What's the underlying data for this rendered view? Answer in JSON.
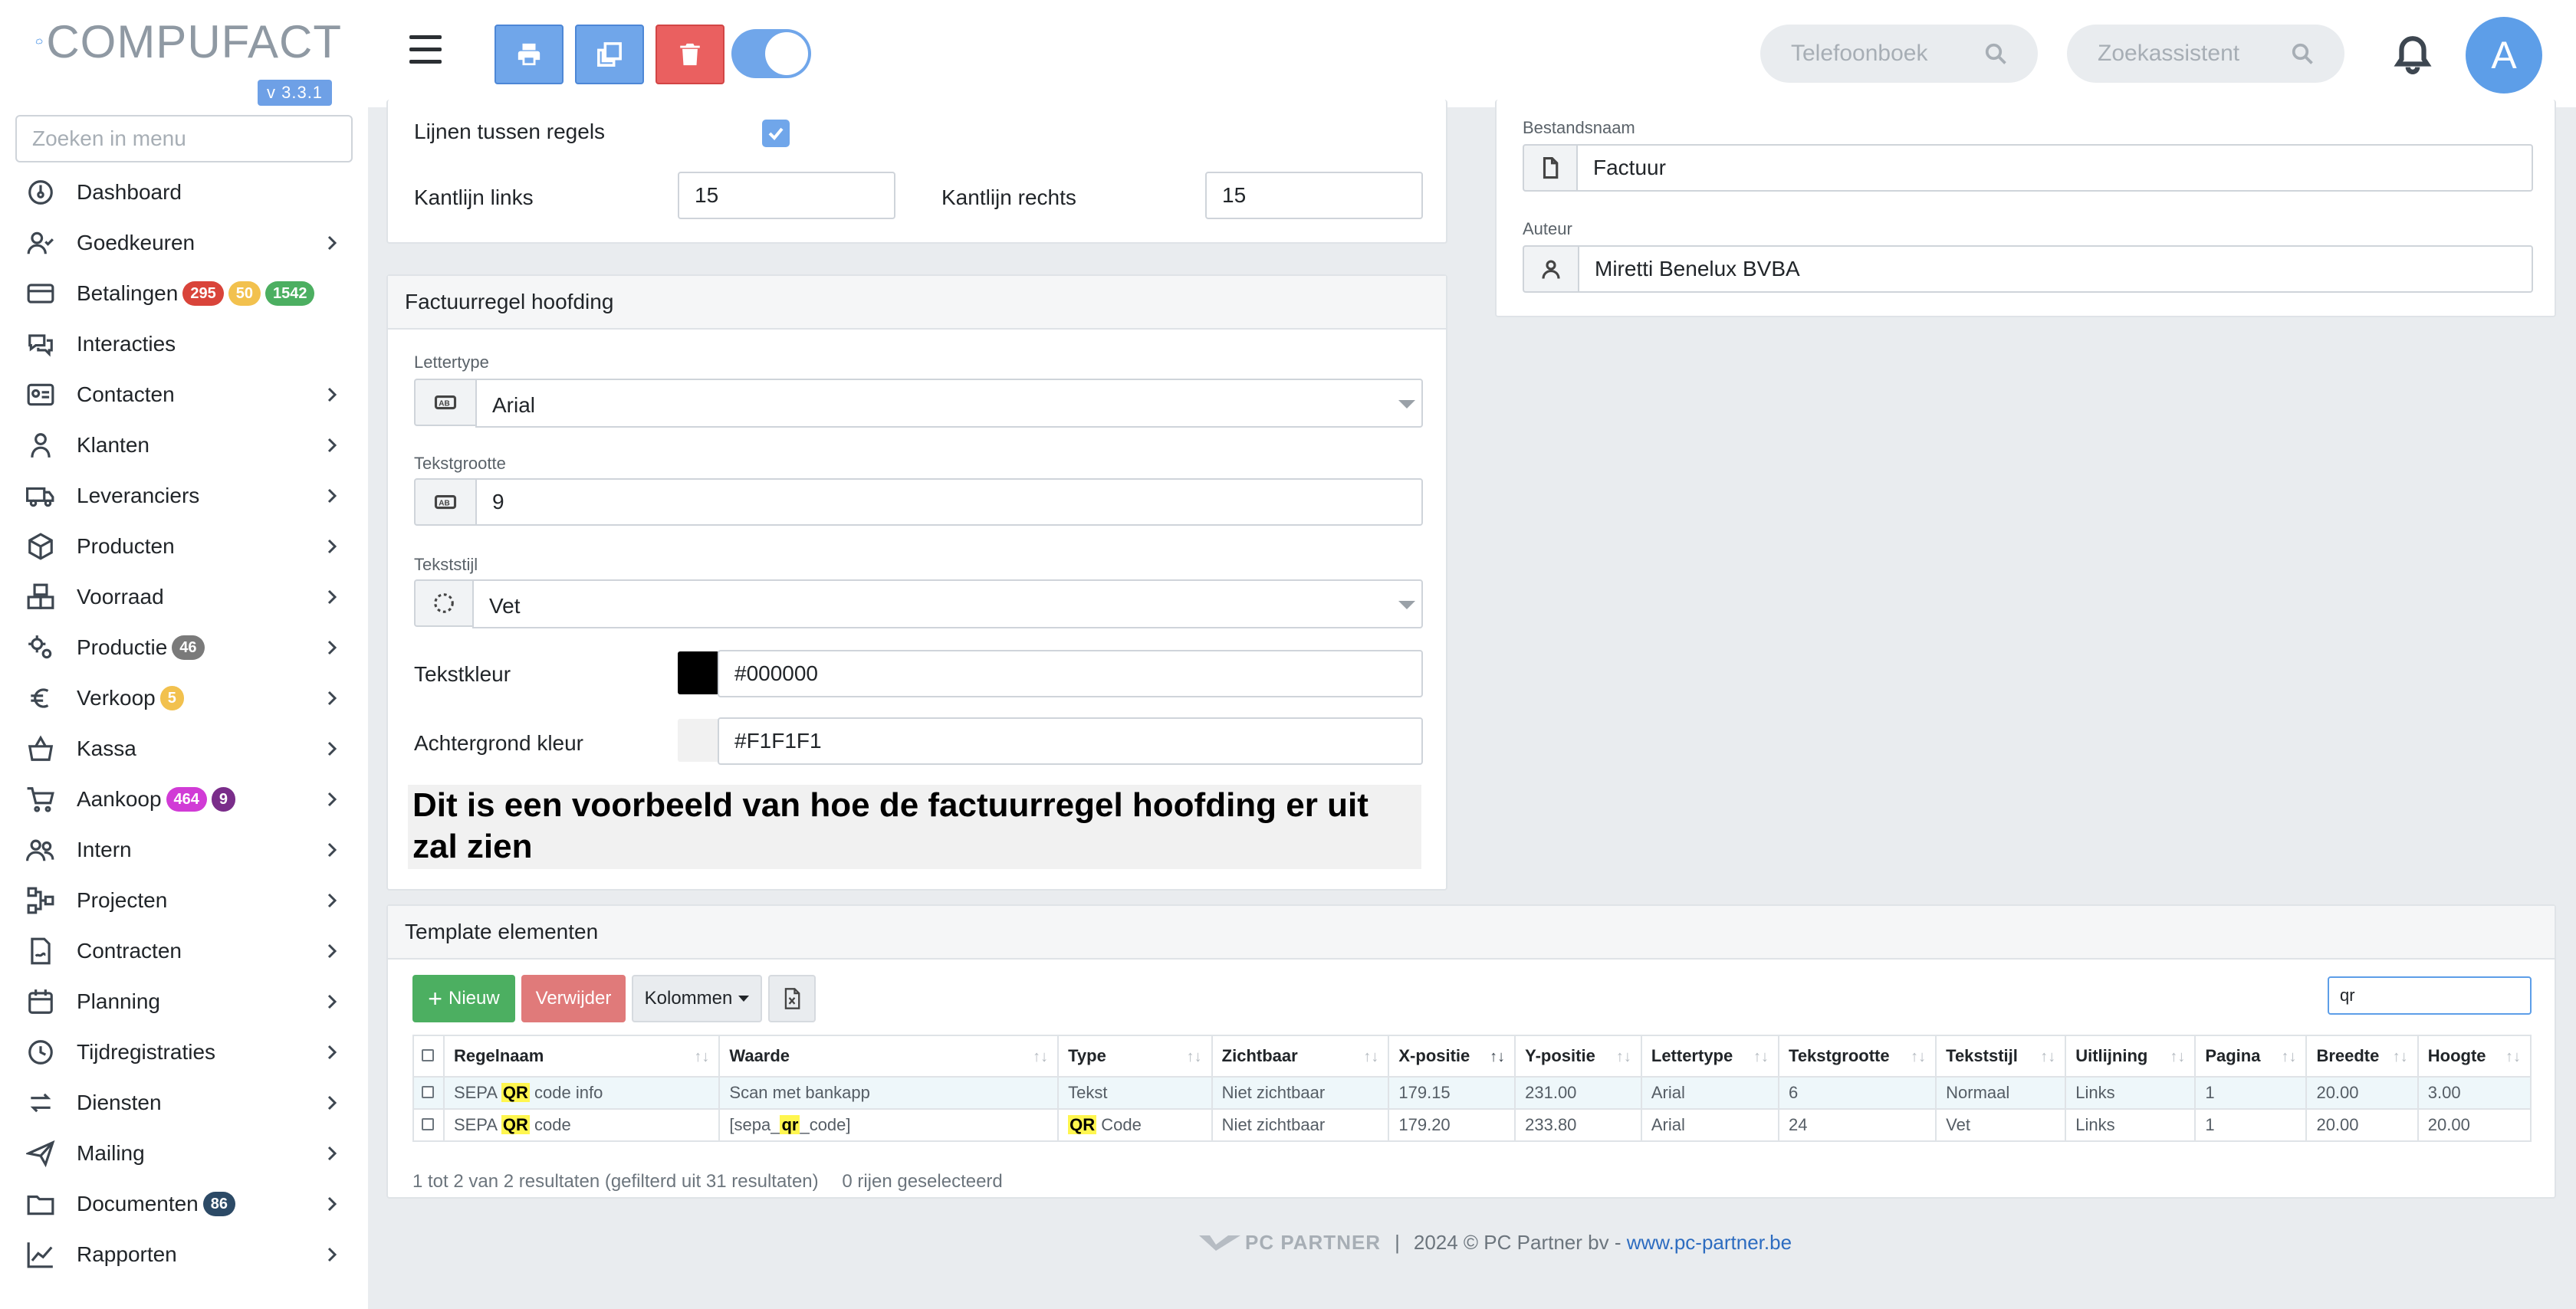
{
  "app": {
    "brand": "COMPUFACT",
    "version": "v 3.3.1",
    "menu_search_placeholder": "Zoeken in menu"
  },
  "nav": [
    {
      "label": "Dashboard",
      "icon": "dashboard-icon",
      "chevron": false,
      "badges": []
    },
    {
      "label": "Goedkeuren",
      "icon": "user-check-icon",
      "chevron": true,
      "badges": []
    },
    {
      "label": "Betalingen",
      "icon": "credit-card-icon",
      "chevron": false,
      "badges": [
        {
          "text": "295",
          "color": "red"
        },
        {
          "text": "50",
          "color": "yellow"
        },
        {
          "text": "1542",
          "color": "green"
        }
      ]
    },
    {
      "label": "Interacties",
      "icon": "chat-icon",
      "chevron": false,
      "badges": []
    },
    {
      "label": "Contacten",
      "icon": "contact-card-icon",
      "chevron": true,
      "badges": []
    },
    {
      "label": "Klanten",
      "icon": "customer-icon",
      "chevron": true,
      "badges": []
    },
    {
      "label": "Leveranciers",
      "icon": "truck-icon",
      "chevron": true,
      "badges": []
    },
    {
      "label": "Producten",
      "icon": "box-icon",
      "chevron": true,
      "badges": []
    },
    {
      "label": "Voorraad",
      "icon": "boxes-icon",
      "chevron": true,
      "badges": []
    },
    {
      "label": "Productie",
      "icon": "gears-icon",
      "chevron": true,
      "badges": [
        {
          "text": "46",
          "color": "gray"
        }
      ]
    },
    {
      "label": "Verkoop",
      "icon": "euro-icon",
      "chevron": true,
      "badges": [
        {
          "text": "5",
          "color": "yellow"
        }
      ]
    },
    {
      "label": "Kassa",
      "icon": "basket-icon",
      "chevron": true,
      "badges": []
    },
    {
      "label": "Aankoop",
      "icon": "cart-icon",
      "chevron": true,
      "badges": [
        {
          "text": "464",
          "color": "magenta"
        },
        {
          "text": "9",
          "color": "purple"
        }
      ]
    },
    {
      "label": "Intern",
      "icon": "users-icon",
      "chevron": true,
      "badges": []
    },
    {
      "label": "Projecten",
      "icon": "diagram-icon",
      "chevron": true,
      "badges": []
    },
    {
      "label": "Contracten",
      "icon": "contract-icon",
      "chevron": true,
      "badges": []
    },
    {
      "label": "Planning",
      "icon": "calendar-icon",
      "chevron": true,
      "badges": []
    },
    {
      "label": "Tijdregistraties",
      "icon": "clock-icon",
      "chevron": true,
      "badges": []
    },
    {
      "label": "Diensten",
      "icon": "exchange-icon",
      "chevron": true,
      "badges": []
    },
    {
      "label": "Mailing",
      "icon": "paper-plane-icon",
      "chevron": true,
      "badges": []
    },
    {
      "label": "Documenten",
      "icon": "folder-icon",
      "chevron": true,
      "badges": [
        {
          "text": "86",
          "color": "navy"
        }
      ]
    },
    {
      "label": "Rapporten",
      "icon": "chart-line-icon",
      "chevron": true,
      "badges": []
    }
  ],
  "topbar": {
    "phonebook_placeholder": "Telefoonboek",
    "assistant_placeholder": "Zoekassistent",
    "avatar_initial": "A"
  },
  "layout_card": {
    "lines_label": "Lijnen tussen regels",
    "lines_checked": true,
    "margin_left_label": "Kantlijn links",
    "margin_left_value": "15",
    "margin_right_label": "Kantlijn rechts",
    "margin_right_value": "15"
  },
  "header_card": {
    "title": "Factuurregel hoofding",
    "font_label": "Lettertype",
    "font_value": "Arial",
    "size_label": "Tekstgrootte",
    "size_value": "9",
    "style_label": "Tekststijl",
    "style_value": "Vet",
    "text_color_label": "Tekstkleur",
    "text_color_value": "#000000",
    "bg_color_label": "Achtergrond kleur",
    "bg_color_value": "#F1F1F1",
    "preview_text": "Dit is een voorbeeld van hoe de factuurregel hoofding er uit zal zien"
  },
  "file_card": {
    "filename_label": "Bestandsnaam",
    "filename_value": "Factuur",
    "author_label": "Auteur",
    "author_value": "Miretti Benelux BVBA"
  },
  "template_card": {
    "title": "Template elementen",
    "new_label": "Nieuw",
    "delete_label": "Verwijder",
    "columns_label": "Kolommen",
    "search_value": "qr",
    "columns": [
      "Regelnaam",
      "Waarde",
      "Type",
      "Zichtbaar",
      "X-positie",
      "Y-positie",
      "Lettertype",
      "Tekstgrootte",
      "Tekststijl",
      "Uitlijning",
      "Pagina",
      "Breedte",
      "Hoogte"
    ],
    "rows": [
      {
        "regelnaam": [
          "SEPA ",
          "QR",
          " code info"
        ],
        "waarde": [
          "Scan met bankapp"
        ],
        "type": [
          "Tekst"
        ],
        "zichtbaar": "Niet zichtbaar",
        "x": "179.15",
        "y": "231.00",
        "font": "Arial",
        "size": "6",
        "style": "Normaal",
        "align": "Links",
        "page": "1",
        "width": "20.00",
        "height": "3.00"
      },
      {
        "regelnaam": [
          "SEPA ",
          "QR",
          " code"
        ],
        "waarde": [
          "[sepa_",
          "qr",
          "_code]"
        ],
        "type": [
          "",
          "QR",
          " Code"
        ],
        "zichtbaar": "Niet zichtbaar",
        "x": "179.20",
        "y": "233.80",
        "font": "Arial",
        "size": "24",
        "style": "Vet",
        "align": "Links",
        "page": "1",
        "width": "20.00",
        "height": "20.00"
      }
    ],
    "info": "1 tot 2 van 2 resultaten (gefilterd uit 31 resultaten)",
    "selected_info": "0 rijen geselecteerd"
  },
  "footer": {
    "logo_text": "PC PARTNER",
    "separator": "|",
    "copyright": "2024 © PC Partner bv - ",
    "link": "www.pc-partner.be"
  }
}
